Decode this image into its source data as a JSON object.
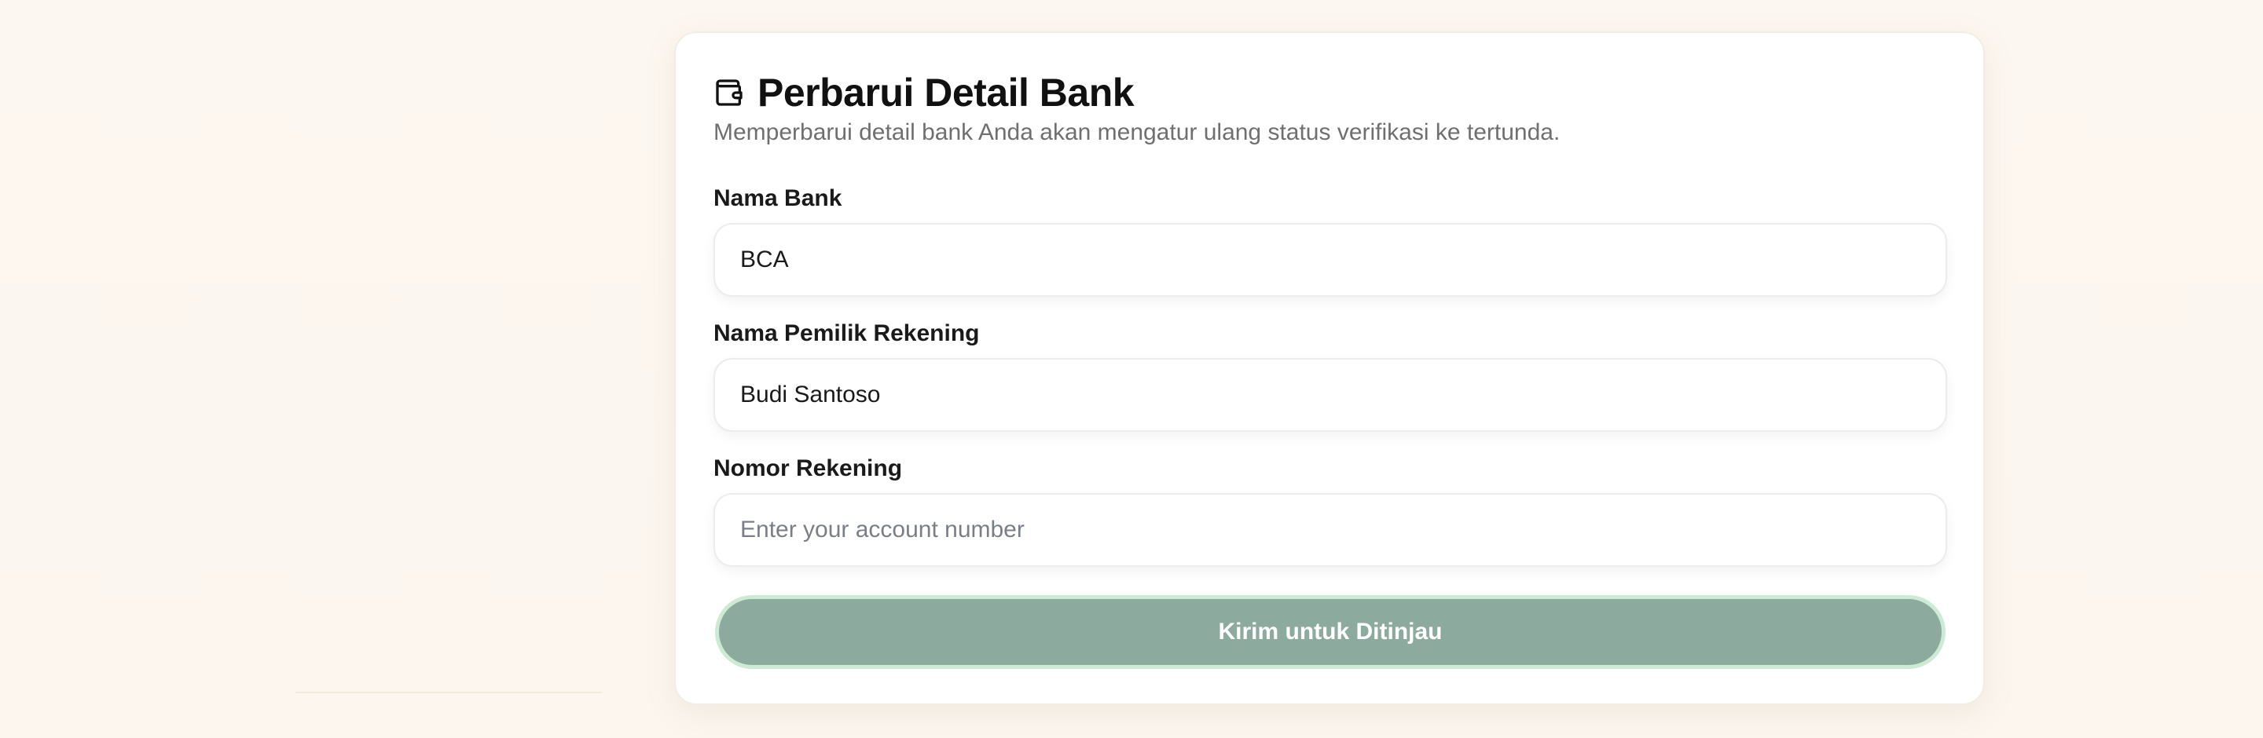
{
  "form": {
    "title": "Perbarui Detail Bank",
    "subtitle": "Memperbarui detail bank Anda akan mengatur ulang status verifikasi ke tertunda.",
    "icon": "wallet-icon",
    "fields": {
      "bank_name": {
        "label": "Nama Bank",
        "value": "BCA"
      },
      "account_holder": {
        "label": "Nama Pemilik Rekening",
        "value": "Budi Santoso"
      },
      "account_number": {
        "label": "Nomor Rekening",
        "value": "",
        "placeholder": "Enter your account number"
      }
    },
    "submit_label": "Kirim untuk Ditinjau"
  },
  "colors": {
    "background": "#fdf7f1",
    "card": "#ffffff",
    "button": "#8cab9e",
    "button_ring": "#cdebd4",
    "subtitle_text": "#6f6f6f"
  }
}
